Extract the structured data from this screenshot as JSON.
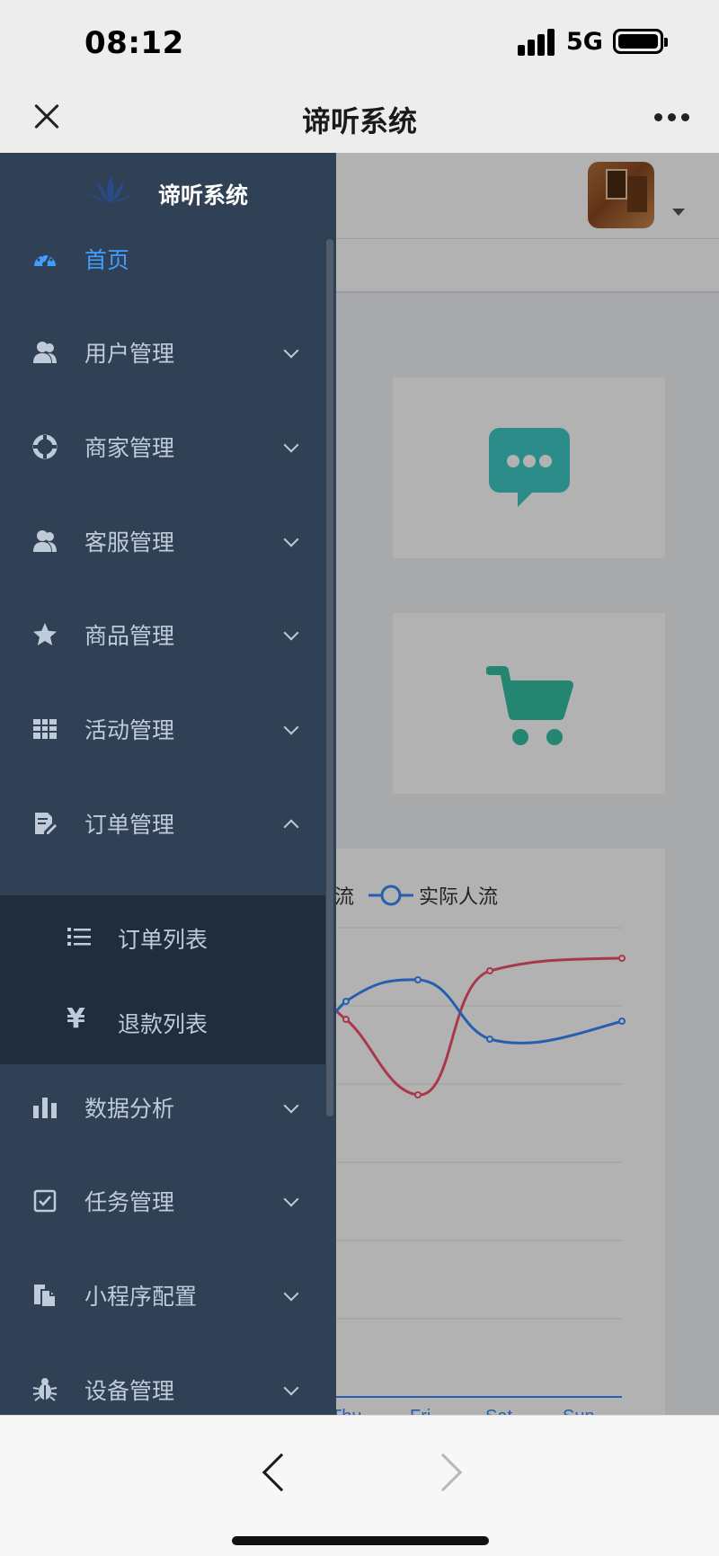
{
  "status_bar": {
    "time": "08:12",
    "network": "5G"
  },
  "title_bar": {
    "title": "谛听系统"
  },
  "sidebar": {
    "logo_text": "谛听系统",
    "items": [
      {
        "label": "首页",
        "icon": "dashboard-icon",
        "active": true
      },
      {
        "label": "用户管理",
        "icon": "users-icon",
        "expandable": true
      },
      {
        "label": "商家管理",
        "icon": "lifebuoy-icon",
        "expandable": true
      },
      {
        "label": "客服管理",
        "icon": "users-icon",
        "expandable": true
      },
      {
        "label": "商品管理",
        "icon": "star-icon",
        "expandable": true
      },
      {
        "label": "活动管理",
        "icon": "table-icon",
        "expandable": true
      },
      {
        "label": "订单管理",
        "icon": "edit-document-icon",
        "expanded": true
      },
      {
        "label": "数据分析",
        "icon": "bar-chart-icon",
        "expandable": true
      },
      {
        "label": "任务管理",
        "icon": "checkbox-icon",
        "expandable": true
      },
      {
        "label": "小程序配置",
        "icon": "documents-icon",
        "expandable": true
      },
      {
        "label": "设备管理",
        "icon": "bug-icon",
        "expandable": true
      }
    ],
    "order_submenu": [
      {
        "label": "订单列表",
        "icon": "list-icon"
      },
      {
        "label": "退款列表",
        "icon": "yen-icon",
        "glyph": "¥"
      }
    ]
  },
  "colors": {
    "sidebar_bg": "#304156",
    "submenu_bg": "#1f2d3d",
    "menu_text": "#bfcbd9",
    "active_text": "#409eff",
    "chat_card": "#40c9c6",
    "cart_card": "#34bfa3",
    "series_expected": "#f4516c",
    "series_actual": "#3888fa"
  },
  "background_page": {
    "legend": {
      "expected_partial": "流",
      "actual": "实际人流"
    },
    "x_axis_partial": [
      "Thu",
      "Fri",
      "Sat",
      "Sun"
    ]
  },
  "chart_data": {
    "type": "line",
    "categories": [
      "Thu",
      "Fri",
      "Sat",
      "Sun"
    ],
    "series": [
      {
        "name": "实际人流",
        "color": "#3888fa"
      },
      {
        "name": "流",
        "color": "#f4516c"
      }
    ]
  }
}
